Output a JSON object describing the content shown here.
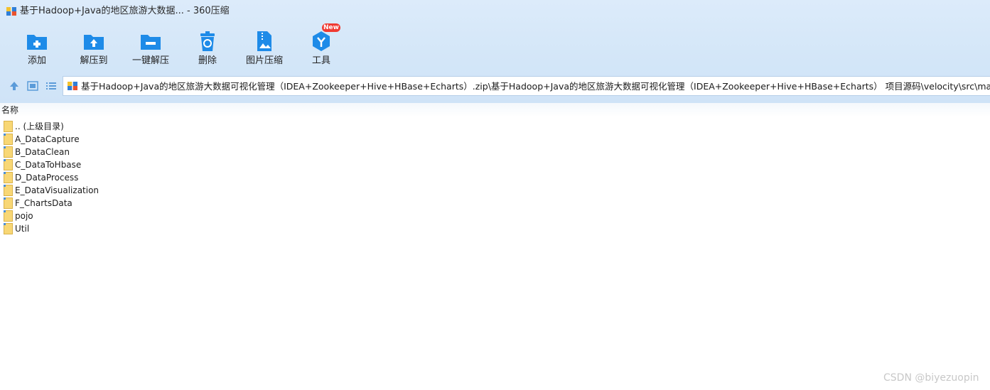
{
  "window": {
    "title": "基于Hadoop+Java的地区旅游大数据... - 360压缩",
    "app_icon": "archive-icon"
  },
  "toolbar": {
    "buttons": [
      {
        "label": "添加",
        "icon": "add-folder-icon"
      },
      {
        "label": "解压到",
        "icon": "extract-to-icon"
      },
      {
        "label": "一键解压",
        "icon": "one-click-extract-icon"
      },
      {
        "label": "删除",
        "icon": "trash-icon"
      },
      {
        "label": "图片压缩",
        "icon": "image-compress-icon"
      },
      {
        "label": "工具",
        "icon": "tools-icon"
      }
    ],
    "badge": "New",
    "accent": "#1e8be8",
    "badge_color": "#f03a32"
  },
  "nav": {
    "up_icon": "up-arrow-icon",
    "thumbnail_view_icon": "thumbnail-view-icon",
    "list_view_icon": "list-view-icon"
  },
  "address": {
    "path": "基于Hadoop+Java的地区旅游大数据可视化管理（IDEA+Zookeeper+Hive+HBase+Echarts）.zip\\基于Hadoop+Java的地区旅游大数据可视化管理（IDEA+Zookeeper+Hive+HBase+Echarts） 项目源码\\velocity\\src\\main\\java - 解包大小"
  },
  "list": {
    "column_name": "名称",
    "items": [
      ".. (上级目录)",
      "A_DataCapture",
      "B_DataClean",
      "C_DataToHbase",
      "D_DataProcess",
      "E_DataVisualization",
      "F_ChartsData",
      "pojo",
      "Util"
    ]
  },
  "watermark": "CSDN @biyezuopin"
}
